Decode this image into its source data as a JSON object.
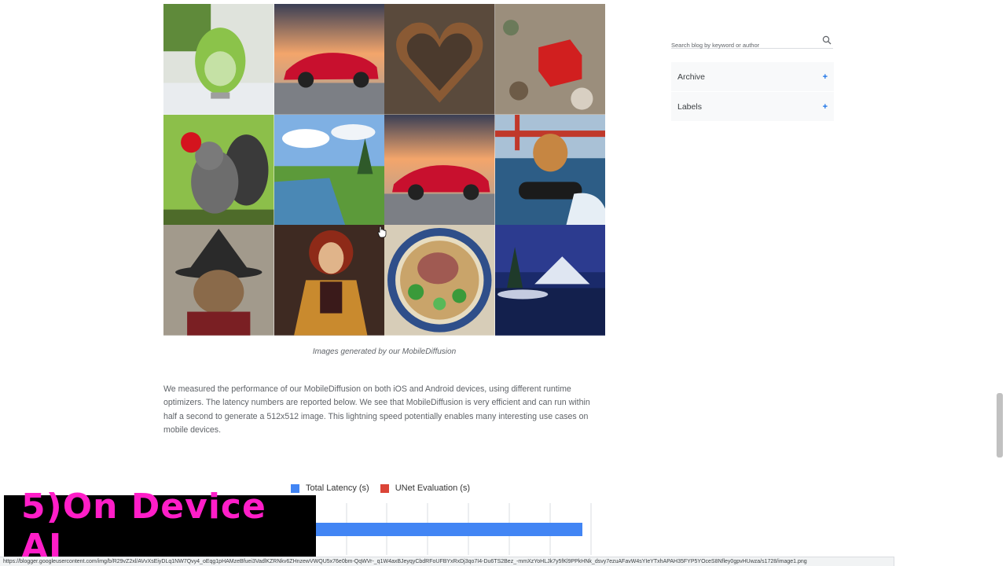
{
  "gallery": {
    "caption": "Images generated by our MobileDiffusion",
    "tiles": [
      "green pear chair",
      "red sports car at sunset",
      "wooden heart",
      "red cube on pebbles",
      "squirrel holding apple",
      "lake landscape",
      "red sports car at sunset",
      "teddy bear on jet ski",
      "cat in witch hat",
      "woman with red hair",
      "beef pho bowl",
      "snowy mountain lake at night"
    ]
  },
  "article": {
    "paragraph": "We measured the performance of our MobileDiffusion on both iOS and Android devices, using different runtime optimizers. The latency numbers are reported below. We see that MobileDiffusion is very efficient and can run within half a second to generate a 512x512 image. This lightning speed potentially enables many interesting use cases on mobile devices."
  },
  "chart_data": {
    "type": "bar",
    "legend": [
      "Total Latency (s)",
      "UNet Evaluation (s)"
    ],
    "colors": {
      "total": "#4285f4",
      "unet": "#db4437"
    },
    "grid": true,
    "legend_position": "top"
  },
  "sidebar": {
    "search_placeholder": "Search blog by keyword or author",
    "archive_label": "Archive",
    "labels_label": "Labels",
    "plus": "+"
  },
  "overlay": {
    "text": "5)On Device AI"
  },
  "status": {
    "url": "https://blogger.googleusercontent.com/img/b/R29vZ2xl/AVvXsEiyDLq1NW7Qvy4_oEqg1pHAMzeBfuei3VadlKZRNkv6ZHnzewVWQU5x76e0bm-QqWVr-_q1W4axBJeyqyCbdRFoUFBYxRxDj3qo7I4-Du6TS2Bez_-mmXzYoHLJk7y5fKl9PPkHNk_dsvy7ezuAFavW4sYIeYTxhAPAH35FYP5YOceS8Nfley0gpvHUwza/s1728/image1.png"
  }
}
